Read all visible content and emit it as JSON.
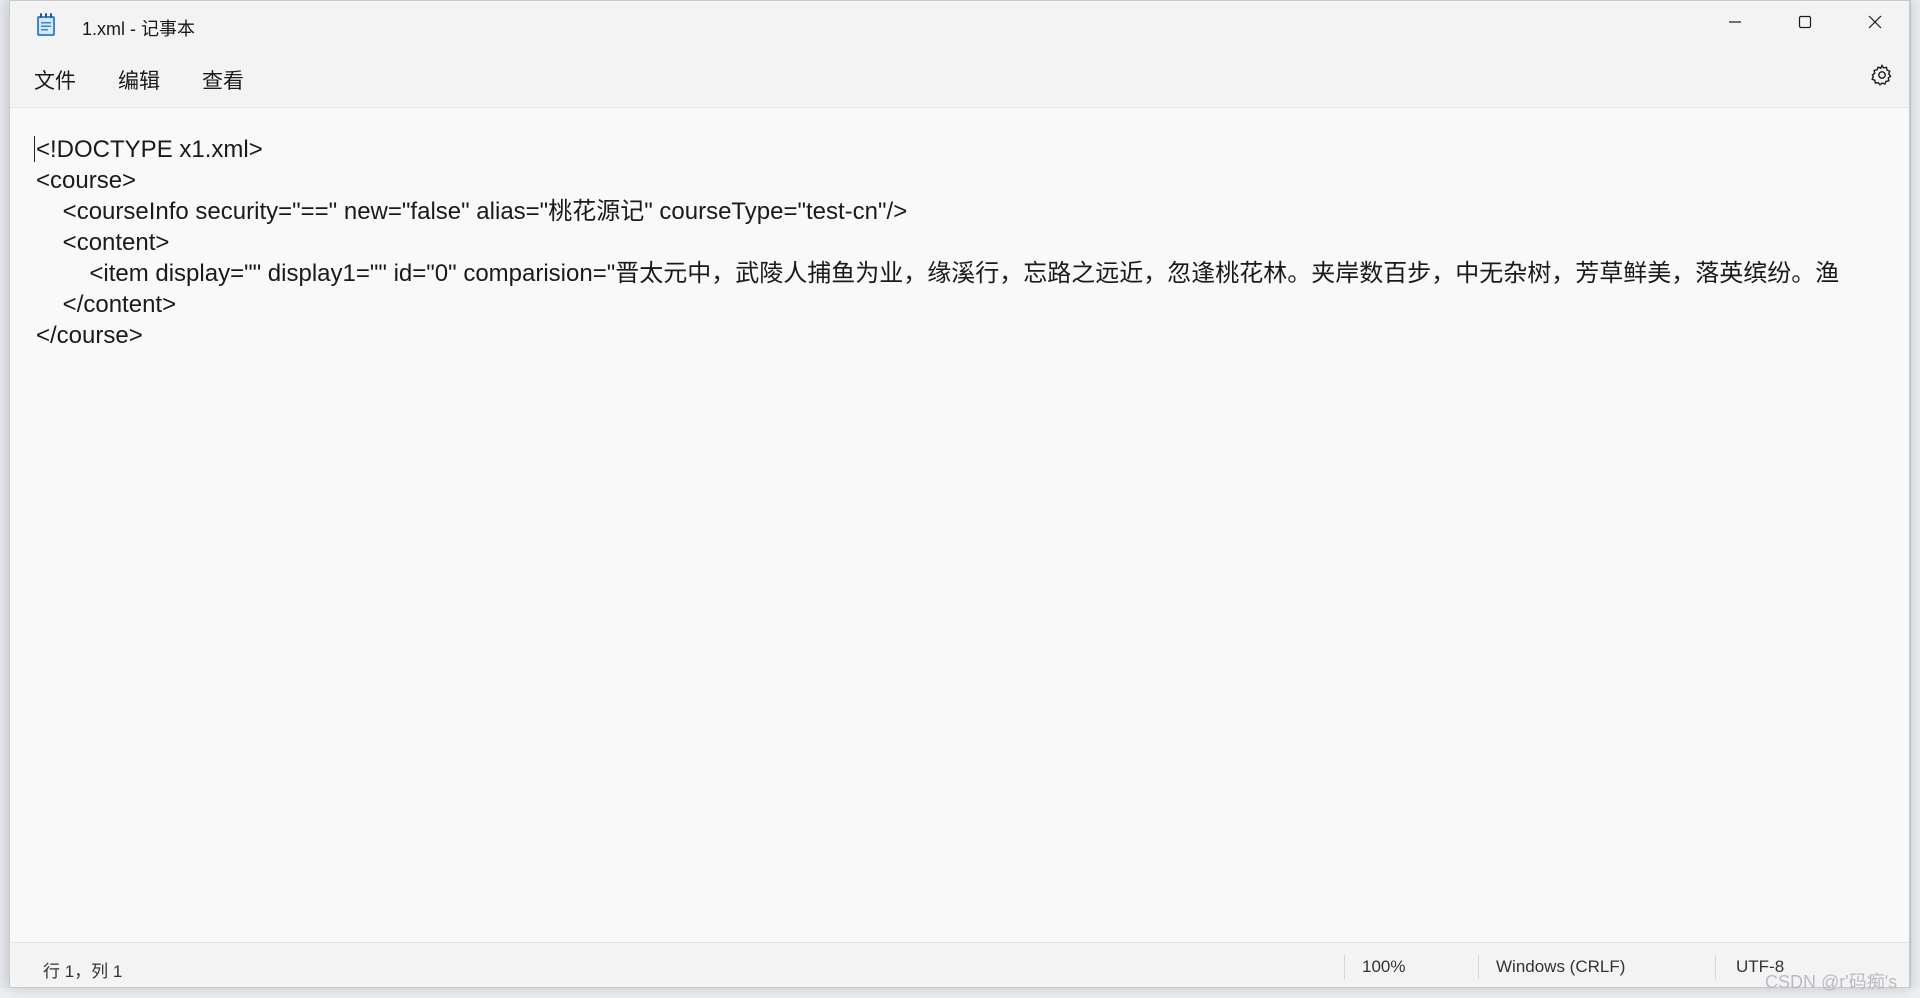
{
  "window": {
    "title": "1.xml - 记事本",
    "app_icon": "notepad-icon",
    "controls": {
      "minimize_icon": "minimize-icon",
      "maximize_icon": "maximize-icon",
      "close_icon": "close-icon"
    }
  },
  "menu": {
    "items": [
      {
        "label": "文件"
      },
      {
        "label": "编辑"
      },
      {
        "label": "查看"
      }
    ],
    "settings_icon": "gear-icon"
  },
  "editor": {
    "lines": [
      "<!DOCTYPE x1.xml>",
      "<course>",
      "    <courseInfo security=\"==\" new=\"false\" alias=\"桃花源记\" courseType=\"test-cn\"/>",
      "    <content>",
      "        <item display=\"\" display1=\"\" id=\"0\" comparision=\"晋太元中，武陵人捕鱼为业，缘溪行，忘路之远近，忽逢桃花林。夹岸数百步，中无杂树，芳草鲜美，落英缤纷。渔",
      "    </content>",
      "</course>"
    ]
  },
  "status": {
    "position": "行 1，列 1",
    "zoom": "100%",
    "line_ending": "Windows (CRLF)",
    "encoding": "UTF-8"
  },
  "watermark": "CSDN @r'码痴's",
  "colors": {
    "window_bg": "#f9f9f9",
    "chrome_bg": "#f3f3f3",
    "text": "#1a1a1a",
    "icon_blue": "#2b6fd6"
  }
}
